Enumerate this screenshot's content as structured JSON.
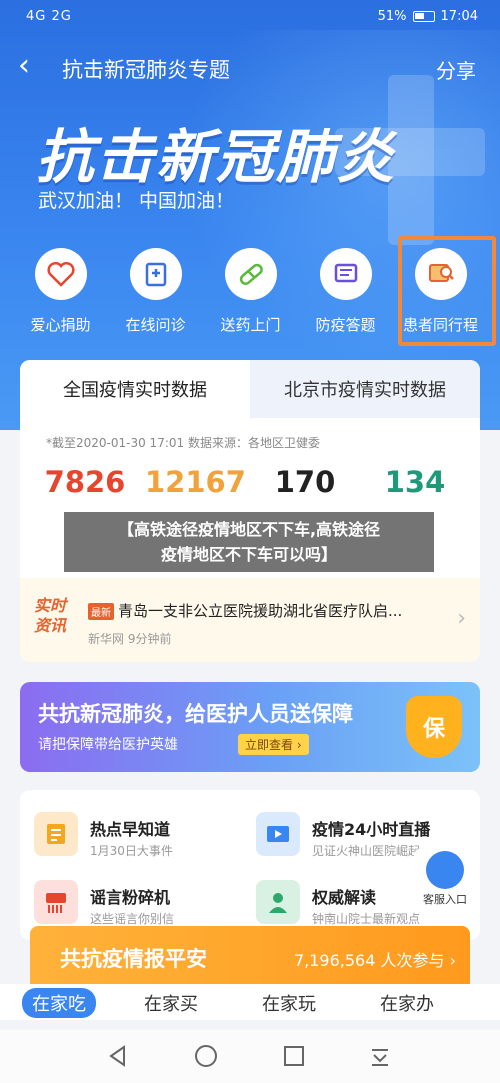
{
  "status": {
    "signal": "4G 2G",
    "battery": "51%",
    "time": "17:04"
  },
  "nav": {
    "title": "抗击新冠肺炎专题",
    "share": "分享"
  },
  "banner": {
    "title": "抗击新冠肺炎",
    "subtitle": "武汉加油！ 中国加油！"
  },
  "quick": [
    {
      "label": "爱心捐助",
      "icon": "heart-icon"
    },
    {
      "label": "在线问诊",
      "icon": "hospital-icon"
    },
    {
      "label": "送药上门",
      "icon": "pill-icon"
    },
    {
      "label": "防疫答题",
      "icon": "quiz-icon"
    },
    {
      "label": "患者同行程",
      "icon": "itinerary-search-icon"
    }
  ],
  "data_card": {
    "tab_national": "全国疫情实时数据",
    "tab_beijing": "北京市疫情实时数据",
    "update": "*截至2020-01-30 17:01 数据来源：各地区卫健委",
    "stats": [
      "7826",
      "12167",
      "170",
      "134"
    ],
    "stat_colors": [
      "#e8452e",
      "#f2a23a",
      "#222222",
      "#1d9a7a"
    ]
  },
  "news": {
    "tag": "实时资讯",
    "badge": "最新",
    "text": "青岛一支非公立医院援助湖北省医疗队启...",
    "meta": "新华网  9分钟前"
  },
  "overlay": {
    "line1": "【高铁途径疫情地区不下车,高铁途径",
    "line2": "疫情地区不下车可以吗】"
  },
  "promo": {
    "title": "共抗新冠肺炎，给医护人员送保障",
    "subtitle": "请把保障带给医护英雄",
    "button": "立即查看 ›",
    "shield": "保"
  },
  "grid": [
    {
      "title": "热点早知道",
      "sub": "1月30日大事件"
    },
    {
      "title": "疫情24小时直播",
      "sub": "见证火神山医院崛起"
    },
    {
      "title": "谣言粉碎机",
      "sub": "这些谣言你别信"
    },
    {
      "title": "权威解读",
      "sub": "钟南山院士最新观点"
    }
  ],
  "kefu": "客服入口",
  "bar": {
    "title": "共抗疫情报平安",
    "count": "7,196,564 人次参与 ›"
  },
  "bottom_tabs": [
    "在家吃",
    "在家买",
    "在家玩",
    "在家办"
  ],
  "colors": {
    "accent": "#3a86f0",
    "highlight": "#f08a3a"
  }
}
